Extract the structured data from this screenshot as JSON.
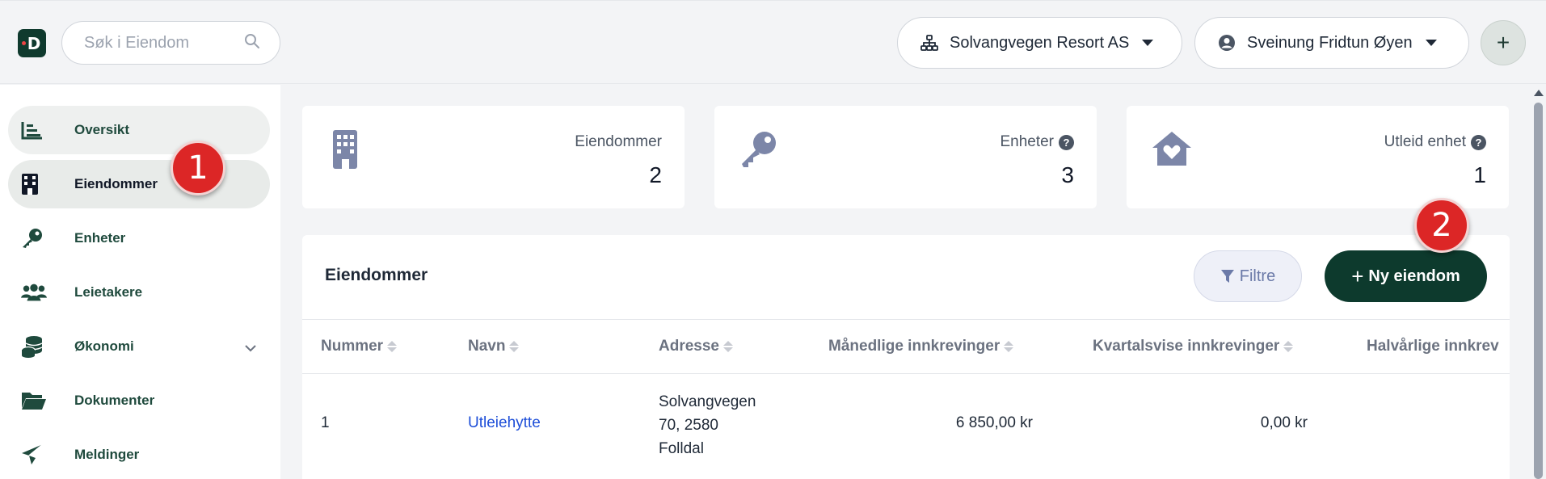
{
  "header": {
    "logo_letter": "D",
    "search_placeholder": "Søk i Eiendom",
    "org_name": "Solvangvegen Resort AS",
    "user_name": "Sveinung Fridtun Øyen",
    "add_label": "+"
  },
  "sidebar": {
    "items": [
      {
        "label": "Oversikt",
        "icon": "chart-bars-icon"
      },
      {
        "label": "Eiendommer",
        "icon": "building-icon"
      },
      {
        "label": "Enheter",
        "icon": "key-icon"
      },
      {
        "label": "Leietakere",
        "icon": "users-icon"
      },
      {
        "label": "Økonomi",
        "icon": "coins-icon"
      },
      {
        "label": "Dokumenter",
        "icon": "folder-icon"
      },
      {
        "label": "Meldinger",
        "icon": "paper-plane-icon"
      }
    ]
  },
  "stats": [
    {
      "label": "Eiendommer",
      "value": "2",
      "icon": "building-icon"
    },
    {
      "label": "Enheter",
      "value": "3",
      "icon": "key-icon",
      "help": "?"
    },
    {
      "label": "Utleid enhet",
      "value": "1",
      "icon": "house-heart-icon",
      "help": "?"
    }
  ],
  "panel": {
    "title": "Eiendommer",
    "filter_label": "Filtre",
    "new_label": "Ny eiendom",
    "new_plus": "+",
    "columns": [
      "Nummer",
      "Navn",
      "Adresse",
      "Månedlige innkrevinger",
      "Kvartalsvise innkrevinger",
      "Halvårlige innkrev"
    ],
    "rows": [
      {
        "nummer": "1",
        "navn": "Utleiehytte",
        "adresse": [
          "Solvangvegen",
          "70, 2580",
          "Folldal"
        ],
        "maanedlige": "6 850,00 kr",
        "kvartalsvise": "0,00 kr"
      }
    ]
  },
  "callouts": [
    "1",
    "2"
  ],
  "colors": {
    "brand_dark": "#0d3a2d",
    "callout_red": "#dc2626",
    "icon_slate": "#7c86a8",
    "link_blue": "#1d4ed8"
  }
}
